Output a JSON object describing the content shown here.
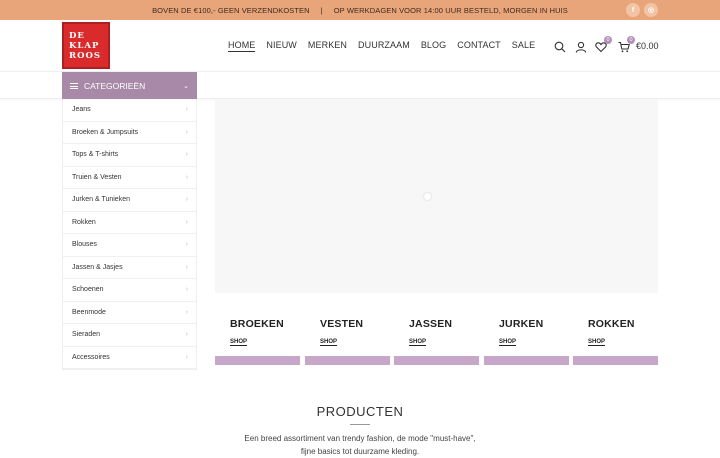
{
  "topbar": {
    "left_text": "BOVEN DE €100,- GEEN VERZENDKOSTEN",
    "separator": "|",
    "right_text": "OP WERKDAGEN VOOR 14:00 UUR BESTELD, MORGEN IN HUIS",
    "facebook": "f",
    "instagram": "◎",
    "bg_color": "#e9a57a"
  },
  "logo": {
    "line1": "DE",
    "line2": "KLAP",
    "line3": "ROOS",
    "color": "#d92b2b"
  },
  "nav": {
    "items": [
      {
        "label": "HOME"
      },
      {
        "label": "NIEUW"
      },
      {
        "label": "MERKEN"
      },
      {
        "label": "DUURZAAM"
      },
      {
        "label": "BLOG"
      },
      {
        "label": "CONTACT"
      },
      {
        "label": "SALE"
      }
    ]
  },
  "header_icons": {
    "search": "search-icon",
    "account": "user-icon",
    "wishlist": "heart-icon",
    "wishlist_count": "0",
    "cart": "cart-icon",
    "cart_count": "0",
    "cart_total": "€0.00"
  },
  "categories": {
    "title": "CATEGORIEËN",
    "chevron": "⌄",
    "items": [
      {
        "label": "Jeans"
      },
      {
        "label": "Broeken & Jumpsuits"
      },
      {
        "label": "Tops & T-shirts"
      },
      {
        "label": "Truien & Vesten"
      },
      {
        "label": "Jurken & Tunieken"
      },
      {
        "label": "Rokken"
      },
      {
        "label": "Blouses"
      },
      {
        "label": "Jassen & Jasjes"
      },
      {
        "label": "Schoenen"
      },
      {
        "label": "Beenmode"
      },
      {
        "label": "Sieraden"
      },
      {
        "label": "Accessoires"
      }
    ],
    "accent_color": "#a88aa8"
  },
  "tiles": [
    {
      "name": "BROEKEN",
      "shop": "SHOP"
    },
    {
      "name": "VESTEN",
      "shop": "SHOP"
    },
    {
      "name": "JASSEN",
      "shop": "SHOP"
    },
    {
      "name": "JURKEN",
      "shop": "SHOP"
    },
    {
      "name": "ROKKEN",
      "shop": "SHOP"
    }
  ],
  "products": {
    "title": "PRODUCTEN",
    "line1": "Een breed assortiment van trendy fashion, de mode \"must-have\",",
    "line2": "fijne basics tot duurzame kleding."
  }
}
